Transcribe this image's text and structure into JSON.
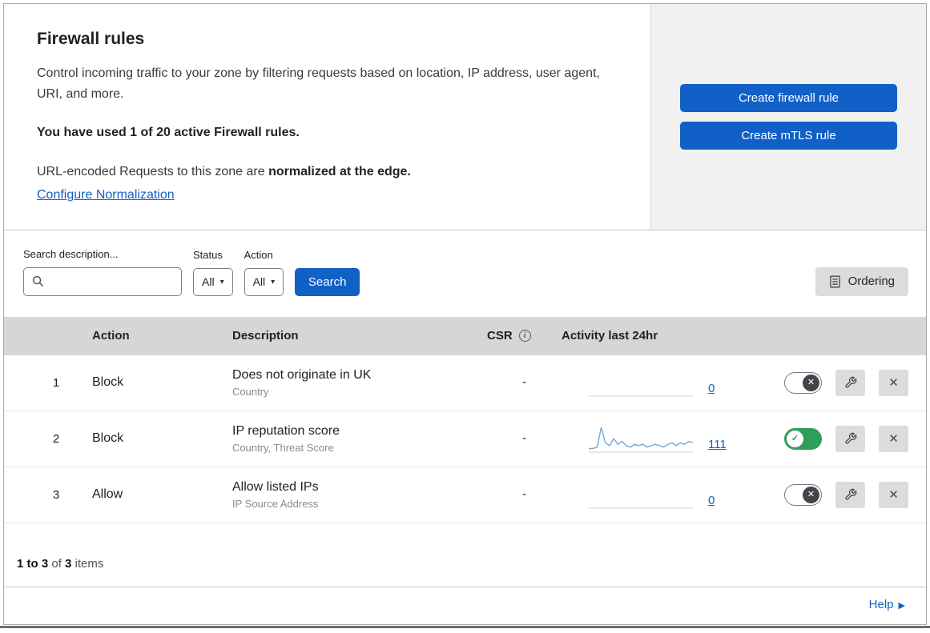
{
  "colors": {
    "accent": "#1160c7",
    "toggle_on": "#2e9e5b",
    "spark": "#6fa8dc",
    "spark_baseline": "#cfcfcf"
  },
  "icons": {
    "caret": "▾",
    "info": "i",
    "check": "✓",
    "cross": "✕",
    "help_arrow": "▶"
  },
  "panel": {
    "title": "Firewall rules",
    "description": "Control incoming traffic to your zone by filtering requests based on location, IP address, user agent, URI, and more.",
    "usage": "You have used 1 of 20 active Firewall rules.",
    "normalization_prefix": "URL-encoded Requests to this zone are ",
    "normalization_bold": "normalized at the edge.",
    "normalization_link": "Configure Normalization",
    "create_firewall_button": "Create firewall rule",
    "create_mtls_button": "Create mTLS rule"
  },
  "toolbar": {
    "search_label": "Search description...",
    "search_value": "",
    "status_label": "Status",
    "status_value": "All",
    "action_label": "Action",
    "action_value": "All",
    "search_button": "Search",
    "ordering_button": "Ordering"
  },
  "table": {
    "headers": {
      "action": "Action",
      "description": "Description",
      "csr": "CSR",
      "activity": "Activity last 24hr"
    },
    "rows": [
      {
        "priority": "1",
        "action": "Block",
        "description": "Does not originate in UK",
        "fields": "Country",
        "csr": "-",
        "count": "0",
        "enabled": false,
        "sparkline": []
      },
      {
        "priority": "2",
        "action": "Block",
        "description": "IP reputation score",
        "fields": "Country, Threat Score",
        "csr": "-",
        "count": "111",
        "enabled": true,
        "sparkline": [
          2,
          2,
          3,
          17,
          6,
          4,
          9,
          5,
          7,
          4,
          3,
          5,
          4,
          5,
          3,
          4,
          5,
          4,
          3,
          5,
          6,
          4,
          6,
          5,
          7,
          6
        ]
      },
      {
        "priority": "3",
        "action": "Allow",
        "description": "Allow listed IPs",
        "fields": "IP Source Address",
        "csr": "-",
        "count": "0",
        "enabled": false,
        "sparkline": []
      }
    ]
  },
  "footer": {
    "range": "1 to 3",
    "of": " of ",
    "total": "3",
    "items": " items"
  },
  "help_label": "Help"
}
